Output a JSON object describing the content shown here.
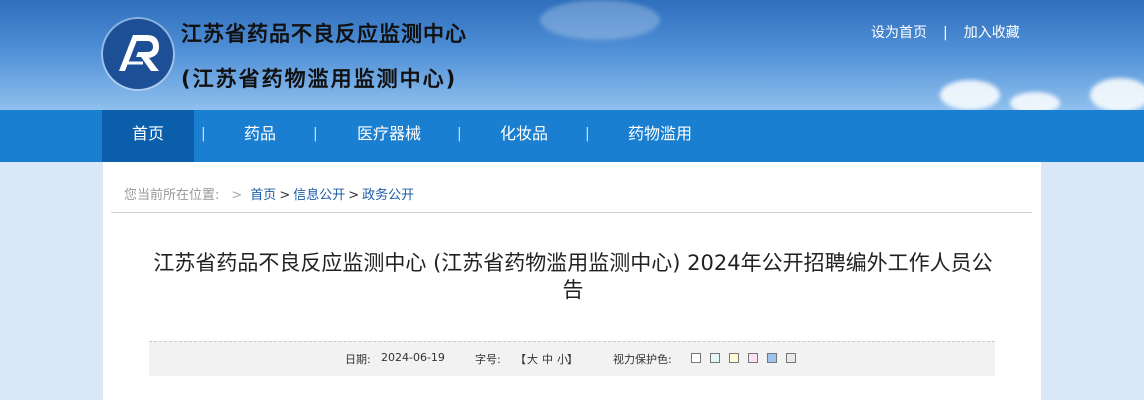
{
  "site": {
    "title_line1": "江苏省药品不良反应监测中心",
    "title_line2": "(江苏省药物滥用监测中心)"
  },
  "top_links": {
    "home": "设为首页",
    "sep": "|",
    "favorite": "加入收藏"
  },
  "nav": {
    "items": [
      {
        "label": "首页"
      },
      {
        "label": "药品"
      },
      {
        "label": "医疗器械"
      },
      {
        "label": "化妆品"
      },
      {
        "label": "药物滥用"
      }
    ],
    "sep": "|"
  },
  "breadcrumb": {
    "prefix": "您当前所在位置:",
    "arrow": ">",
    "items": [
      "首页",
      "信息公开",
      "政务公开"
    ],
    "gt": ">"
  },
  "article": {
    "title": "江苏省药品不良反应监测中心 (江苏省药物滥用监测中心) 2024年公开招聘编外工作人员公告",
    "date_label": "日期:",
    "date": "2024-06-19",
    "font_label": "字号:",
    "font_open": "【",
    "font_large": "大",
    "font_medium": "中",
    "font_small": "小",
    "font_close": "】",
    "eye_label": "视力保护色:",
    "eye_colors": [
      "#ffffff",
      "#e6f7f7",
      "#fffbd6",
      "#fbe0f2",
      "#9cc4ef",
      "#e8e8e8"
    ]
  },
  "colors": {
    "nav_bg": "#1a7fd0",
    "nav_active": "#0b5eaa",
    "link": "#1b5ca8"
  }
}
